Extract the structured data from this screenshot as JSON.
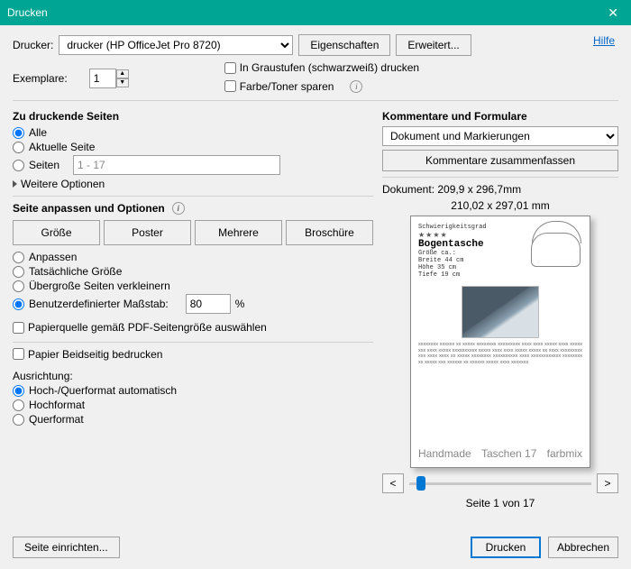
{
  "title": "Drucken",
  "help": "Hilfe",
  "printer": {
    "label": "Drucker:",
    "value": "drucker (HP OfficeJet Pro 8720)",
    "properties": "Eigenschaften",
    "advanced": "Erweitert..."
  },
  "copies": {
    "label": "Exemplare:",
    "value": "1"
  },
  "grayscale": "In Graustufen (schwarzweiß) drucken",
  "savetoner": "Farbe/Toner sparen",
  "pages": {
    "heading": "Zu druckende Seiten",
    "all": "Alle",
    "current": "Aktuelle Seite",
    "range_label": "Seiten",
    "range_value": "1 - 17",
    "more": "Weitere Optionen"
  },
  "fit": {
    "heading": "Seite anpassen und Optionen",
    "size": "Größe",
    "poster": "Poster",
    "multiple": "Mehrere",
    "booklet": "Broschüre",
    "fit_opt": "Anpassen",
    "actual": "Tatsächliche Größe",
    "shrink": "Übergroße Seiten verkleinern",
    "custom": "Benutzerdefinierter Maßstab:",
    "custom_value": "80",
    "percent": "%",
    "papersource": "Papierquelle gemäß PDF-Seitengröße auswählen"
  },
  "duplex": "Papier Beidseitig bedrucken",
  "orient": {
    "heading": "Ausrichtung:",
    "auto": "Hoch-/Querformat automatisch",
    "portrait": "Hochformat",
    "landscape": "Querformat"
  },
  "comments": {
    "heading": "Kommentare und Formulare",
    "option": "Dokument und Markierungen",
    "summarize": "Kommentare zusammenfassen"
  },
  "preview": {
    "doc_dim": "Dokument: 209,9 x 296,7mm",
    "page_dim": "210,02 x 297,01 mm",
    "top_small": "Schwierigkeitsgrad",
    "doc_title": "Bogentasche",
    "spec1": "Größe ca.:",
    "spec2": "Breite  44 cm",
    "spec3": "Höhe   35 cm",
    "spec4": "Tiefe  19 cm",
    "footer_l": "Handmade",
    "footer_m": "Taschen 17",
    "footer_r": "farbmix",
    "page_of": "Seite 1 von 17",
    "prev": "<",
    "next": ">"
  },
  "footer": {
    "pagesetup": "Seite einrichten...",
    "print": "Drucken",
    "cancel": "Abbrechen"
  }
}
